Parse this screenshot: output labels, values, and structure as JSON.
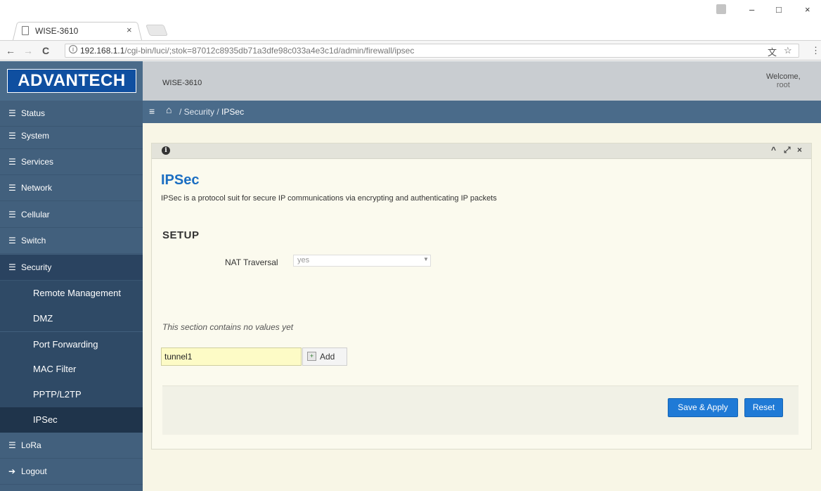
{
  "browser": {
    "tab_title": "WISE-3610",
    "tab_close": "×",
    "url_host": "192.168.1.1",
    "url_path": "/cgi-bin/luci/;stok=87012c8935db71a3dfe98c033a4e3c1d/admin/firewall/ipsec",
    "nav_back": "←",
    "nav_forward": "→",
    "nav_reload": "C",
    "info_glyph": "i",
    "translate_icon": "文",
    "star_icon": "☆",
    "menu_icon": "⋮",
    "win_minimize": "–",
    "win_maximize": "□",
    "win_close": "×"
  },
  "header": {
    "logo": "ADVANTECH",
    "device": "WISE-3610",
    "welcome": "Welcome,",
    "user": "root"
  },
  "sidebar": {
    "items": [
      {
        "label": "Status",
        "icon": "☰"
      },
      {
        "label": "System",
        "icon": "☰"
      },
      {
        "label": "Services",
        "icon": "☰"
      },
      {
        "label": "Network",
        "icon": "☰"
      },
      {
        "label": "Cellular",
        "icon": "☰"
      },
      {
        "label": "Switch",
        "icon": "☰"
      },
      {
        "label": "Security",
        "icon": "☰"
      }
    ],
    "security_sub": [
      {
        "label": "Remote Management"
      },
      {
        "label": "DMZ"
      },
      {
        "label": "Port Forwarding"
      },
      {
        "label": "MAC Filter"
      },
      {
        "label": "PPTP/L2TP"
      },
      {
        "label": "IPSec"
      }
    ],
    "after": [
      {
        "label": "LoRa",
        "icon": "☰"
      },
      {
        "label": "Logout",
        "icon": "➔"
      }
    ]
  },
  "breadcrumb": {
    "menu_icon": "≡",
    "home_icon": "⌂",
    "sep": " / ",
    "section": "Security",
    "current": "IPSec"
  },
  "panel": {
    "info_icon": "i",
    "collapse_icon": "^",
    "expand_icon": "⤢",
    "close_icon": "×"
  },
  "page": {
    "title": "IPSec",
    "description": "IPSec is a protocol suit for secure IP communications via encrypting and authenticating IP packets",
    "setup_title": "SETUP",
    "nat_label": "NAT Traversal",
    "nat_value": "yes",
    "nat_caret": "▼",
    "empty_note": "This section contains no values yet",
    "tunnel_value": "tunnel1",
    "add_label": "Add",
    "add_icon": "+",
    "save_label": "Save & Apply",
    "reset_label": "Reset"
  },
  "colors": {
    "sidebar": "#42607d",
    "sidebar_active": "#2a4360",
    "accent": "#1f7ad6",
    "title_blue": "#1b6ec2",
    "content_bg": "#f8f6e6"
  }
}
